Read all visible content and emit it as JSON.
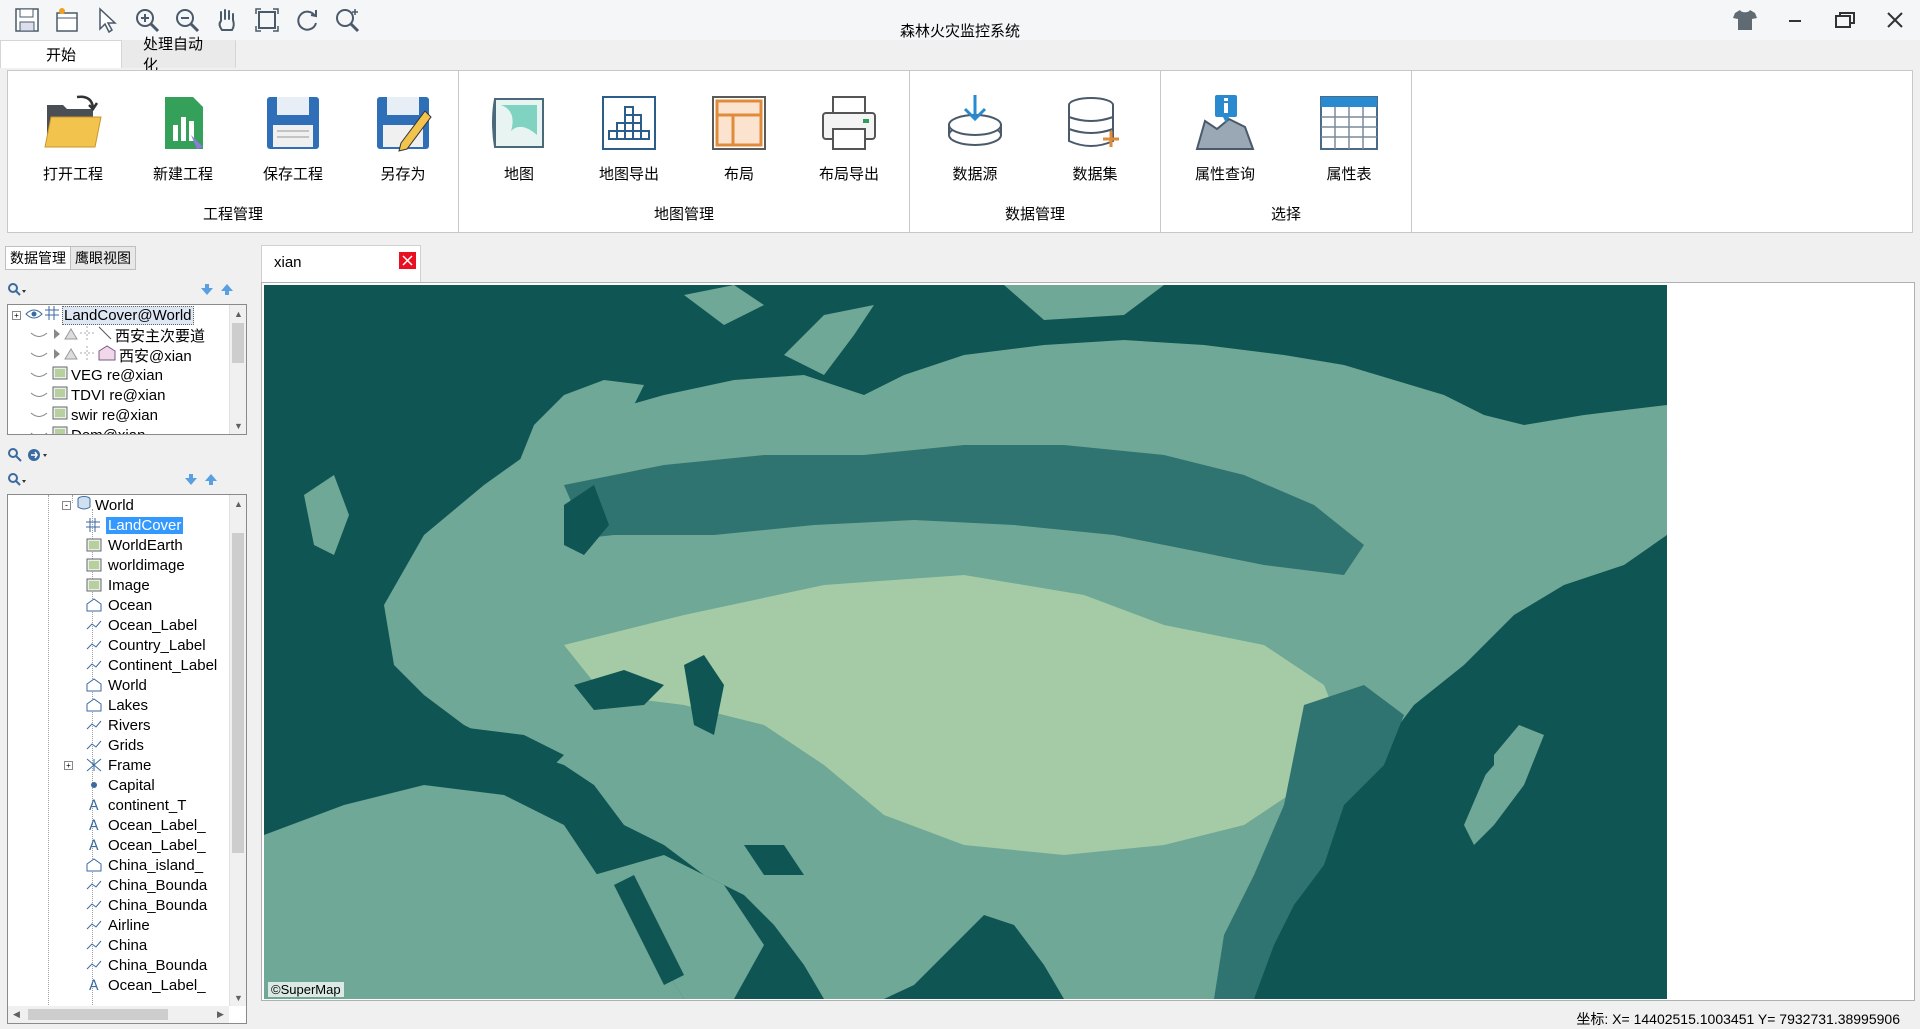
{
  "app": {
    "title": "森林火灾监控系统"
  },
  "quick_access": [
    "save-icon",
    "new-doc-icon",
    "select-arrow-icon",
    "zoom-in-icon",
    "zoom-out-icon",
    "pan-hand-icon",
    "full-extent-icon",
    "refresh-icon",
    "zoom-free-icon"
  ],
  "ribbon_tabs": [
    {
      "label": "开始"
    },
    {
      "label": "处理自动化"
    }
  ],
  "ribbon": {
    "groups": [
      {
        "label": "工程管理",
        "buttons": [
          {
            "label": "打开工程"
          },
          {
            "label": "新建工程"
          },
          {
            "label": "保存工程"
          },
          {
            "label": "另存为"
          }
        ]
      },
      {
        "label": "地图管理",
        "buttons": [
          {
            "label": "地图"
          },
          {
            "label": "地图导出"
          },
          {
            "label": "布局"
          },
          {
            "label": "布局导出"
          }
        ]
      },
      {
        "label": "数据管理",
        "buttons": [
          {
            "label": "数据源"
          },
          {
            "label": "数据集"
          }
        ]
      },
      {
        "label": "选择",
        "buttons": [
          {
            "label": "属性查询"
          },
          {
            "label": "属性表"
          }
        ]
      }
    ]
  },
  "left_panel": {
    "tabs": [
      {
        "label": "数据管理"
      },
      {
        "label": "鹰眼视图"
      }
    ],
    "layers": [
      {
        "name": "LandCover@World"
      },
      {
        "name": "西安主次要道"
      },
      {
        "name": "西安@xian"
      },
      {
        "name": "VEG  re@xian"
      },
      {
        "name": "TDVI  re@xian"
      },
      {
        "name": "swir  re@xian"
      },
      {
        "name": "Dem@xian"
      }
    ],
    "workspace": {
      "root": "World",
      "datasets": [
        {
          "name": "LandCover",
          "icon": "grid"
        },
        {
          "name": "WorldEarth",
          "icon": "image"
        },
        {
          "name": "worldimage",
          "icon": "image"
        },
        {
          "name": "Image",
          "icon": "image"
        },
        {
          "name": "Ocean",
          "icon": "region"
        },
        {
          "name": "Ocean_Label",
          "icon": "line"
        },
        {
          "name": "Country_Label",
          "icon": "line"
        },
        {
          "name": "Continent_Label",
          "icon": "line"
        },
        {
          "name": "World",
          "icon": "region"
        },
        {
          "name": "Lakes",
          "icon": "region"
        },
        {
          "name": "Rivers",
          "icon": "line"
        },
        {
          "name": "Grids",
          "icon": "line"
        },
        {
          "name": "Frame",
          "icon": "network"
        },
        {
          "name": "Capital",
          "icon": "point"
        },
        {
          "name": "continent_T",
          "icon": "text"
        },
        {
          "name": "Ocean_Label_",
          "icon": "text"
        },
        {
          "name": "Ocean_Label_",
          "icon": "text"
        },
        {
          "name": "China_island_",
          "icon": "region"
        },
        {
          "name": "China_Bounda",
          "icon": "line"
        },
        {
          "name": "China_Bounda",
          "icon": "line"
        },
        {
          "name": "Airline",
          "icon": "line"
        },
        {
          "name": "China",
          "icon": "line"
        },
        {
          "name": "China_Bounda",
          "icon": "line"
        },
        {
          "name": "Ocean_Label_",
          "icon": "text"
        }
      ]
    }
  },
  "map_tab": {
    "label": "xian"
  },
  "map": {
    "credit": "©SuperMap",
    "colors": {
      "ocean": "#0e5553",
      "land_light": "#a4cba6",
      "land_mid": "#6fa896",
      "forest": "#2f7470"
    }
  },
  "status": {
    "coords": "坐标:   X= 14402515.1003451 Y= 7932731.38995906"
  }
}
